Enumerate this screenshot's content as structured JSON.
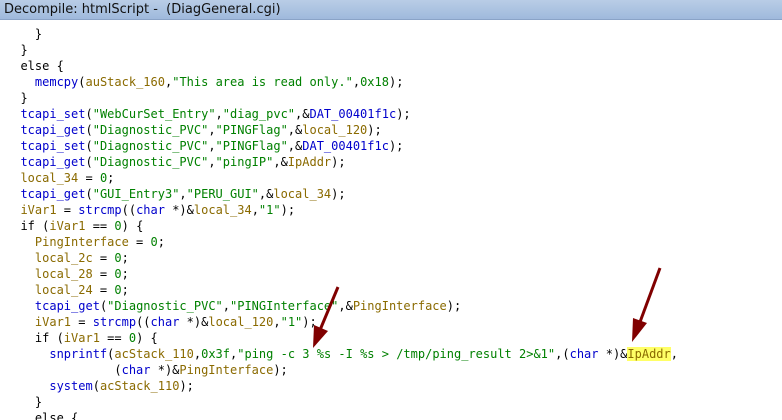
{
  "window": {
    "title": "Decompile: htmlScript -  (DiagGeneral.cgi)"
  },
  "code": {
    "lines": [
      [
        {
          "t": "    }",
          "c": "kw"
        }
      ],
      [
        {
          "t": "  }",
          "c": "kw"
        }
      ],
      [
        {
          "t": "  else {",
          "c": "kw"
        }
      ],
      [
        {
          "t": "    ",
          "c": "kw"
        },
        {
          "t": "memcpy",
          "c": "fn"
        },
        {
          "t": "(",
          "c": "kw"
        },
        {
          "t": "auStack_160",
          "c": "var"
        },
        {
          "t": ",",
          "c": "kw"
        },
        {
          "t": "\"This area is read only.\"",
          "c": "str"
        },
        {
          "t": ",",
          "c": "kw"
        },
        {
          "t": "0x18",
          "c": "num"
        },
        {
          "t": ");",
          "c": "kw"
        }
      ],
      [
        {
          "t": "  }",
          "c": "kw"
        }
      ],
      [
        {
          "t": "  ",
          "c": "kw"
        },
        {
          "t": "tcapi_set",
          "c": "fn"
        },
        {
          "t": "(",
          "c": "kw"
        },
        {
          "t": "\"WebCurSet_Entry\"",
          "c": "str"
        },
        {
          "t": ",",
          "c": "kw"
        },
        {
          "t": "\"diag_pvc\"",
          "c": "str"
        },
        {
          "t": ",&",
          "c": "kw"
        },
        {
          "t": "DAT_00401f1c",
          "c": "gvar"
        },
        {
          "t": ");",
          "c": "kw"
        }
      ],
      [
        {
          "t": "  ",
          "c": "kw"
        },
        {
          "t": "tcapi_get",
          "c": "fn"
        },
        {
          "t": "(",
          "c": "kw"
        },
        {
          "t": "\"Diagnostic_PVC\"",
          "c": "str"
        },
        {
          "t": ",",
          "c": "kw"
        },
        {
          "t": "\"PINGFlag\"",
          "c": "str"
        },
        {
          "t": ",&",
          "c": "kw"
        },
        {
          "t": "local_120",
          "c": "var"
        },
        {
          "t": ");",
          "c": "kw"
        }
      ],
      [
        {
          "t": "  ",
          "c": "kw"
        },
        {
          "t": "tcapi_set",
          "c": "fn"
        },
        {
          "t": "(",
          "c": "kw"
        },
        {
          "t": "\"Diagnostic_PVC\"",
          "c": "str"
        },
        {
          "t": ",",
          "c": "kw"
        },
        {
          "t": "\"PINGFlag\"",
          "c": "str"
        },
        {
          "t": ",&",
          "c": "kw"
        },
        {
          "t": "DAT_00401f1c",
          "c": "gvar"
        },
        {
          "t": ");",
          "c": "kw"
        }
      ],
      [
        {
          "t": "  ",
          "c": "kw"
        },
        {
          "t": "tcapi_get",
          "c": "fn"
        },
        {
          "t": "(",
          "c": "kw"
        },
        {
          "t": "\"Diagnostic_PVC\"",
          "c": "str"
        },
        {
          "t": ",",
          "c": "kw"
        },
        {
          "t": "\"pingIP\"",
          "c": "str"
        },
        {
          "t": ",&",
          "c": "kw"
        },
        {
          "t": "IpAddr",
          "c": "var"
        },
        {
          "t": ");",
          "c": "kw"
        }
      ],
      [
        {
          "t": "  ",
          "c": "kw"
        },
        {
          "t": "local_34",
          "c": "var"
        },
        {
          "t": " = ",
          "c": "kw"
        },
        {
          "t": "0",
          "c": "num"
        },
        {
          "t": ";",
          "c": "kw"
        }
      ],
      [
        {
          "t": "  ",
          "c": "kw"
        },
        {
          "t": "tcapi_get",
          "c": "fn"
        },
        {
          "t": "(",
          "c": "kw"
        },
        {
          "t": "\"GUI_Entry3\"",
          "c": "str"
        },
        {
          "t": ",",
          "c": "kw"
        },
        {
          "t": "\"PERU_GUI\"",
          "c": "str"
        },
        {
          "t": ",&",
          "c": "kw"
        },
        {
          "t": "local_34",
          "c": "var"
        },
        {
          "t": ");",
          "c": "kw"
        }
      ],
      [
        {
          "t": "  ",
          "c": "kw"
        },
        {
          "t": "iVar1",
          "c": "var"
        },
        {
          "t": " = ",
          "c": "kw"
        },
        {
          "t": "strcmp",
          "c": "fn"
        },
        {
          "t": "((",
          "c": "kw"
        },
        {
          "t": "char",
          "c": "fn"
        },
        {
          "t": " *)&",
          "c": "kw"
        },
        {
          "t": "local_34",
          "c": "var"
        },
        {
          "t": ",",
          "c": "kw"
        },
        {
          "t": "\"1\"",
          "c": "str"
        },
        {
          "t": ");",
          "c": "kw"
        }
      ],
      [
        {
          "t": "  if (",
          "c": "kw"
        },
        {
          "t": "iVar1",
          "c": "var"
        },
        {
          "t": " == ",
          "c": "kw"
        },
        {
          "t": "0",
          "c": "num"
        },
        {
          "t": ") {",
          "c": "kw"
        }
      ],
      [
        {
          "t": "    ",
          "c": "kw"
        },
        {
          "t": "PingInterface",
          "c": "var"
        },
        {
          "t": " = ",
          "c": "kw"
        },
        {
          "t": "0",
          "c": "num"
        },
        {
          "t": ";",
          "c": "kw"
        }
      ],
      [
        {
          "t": "    ",
          "c": "kw"
        },
        {
          "t": "local_2c",
          "c": "var"
        },
        {
          "t": " = ",
          "c": "kw"
        },
        {
          "t": "0",
          "c": "num"
        },
        {
          "t": ";",
          "c": "kw"
        }
      ],
      [
        {
          "t": "    ",
          "c": "kw"
        },
        {
          "t": "local_28",
          "c": "var"
        },
        {
          "t": " = ",
          "c": "kw"
        },
        {
          "t": "0",
          "c": "num"
        },
        {
          "t": ";",
          "c": "kw"
        }
      ],
      [
        {
          "t": "    ",
          "c": "kw"
        },
        {
          "t": "local_24",
          "c": "var"
        },
        {
          "t": " = ",
          "c": "kw"
        },
        {
          "t": "0",
          "c": "num"
        },
        {
          "t": ";",
          "c": "kw"
        }
      ],
      [
        {
          "t": "    ",
          "c": "kw"
        },
        {
          "t": "tcapi_get",
          "c": "fn"
        },
        {
          "t": "(",
          "c": "kw"
        },
        {
          "t": "\"Diagnostic_PVC\"",
          "c": "str"
        },
        {
          "t": ",",
          "c": "kw"
        },
        {
          "t": "\"PINGInterface\"",
          "c": "str"
        },
        {
          "t": ",&",
          "c": "kw"
        },
        {
          "t": "PingInterface",
          "c": "var"
        },
        {
          "t": ");",
          "c": "kw"
        }
      ],
      [
        {
          "t": "    ",
          "c": "kw"
        },
        {
          "t": "iVar1",
          "c": "var"
        },
        {
          "t": " = ",
          "c": "kw"
        },
        {
          "t": "strcmp",
          "c": "fn"
        },
        {
          "t": "((",
          "c": "kw"
        },
        {
          "t": "char",
          "c": "fn"
        },
        {
          "t": " *)&",
          "c": "kw"
        },
        {
          "t": "local_120",
          "c": "var"
        },
        {
          "t": ",",
          "c": "kw"
        },
        {
          "t": "\"1\"",
          "c": "str"
        },
        {
          "t": ");",
          "c": "kw"
        }
      ],
      [
        {
          "t": "    if (",
          "c": "kw"
        },
        {
          "t": "iVar1",
          "c": "var"
        },
        {
          "t": " == ",
          "c": "kw"
        },
        {
          "t": "0",
          "c": "num"
        },
        {
          "t": ") {",
          "c": "kw"
        }
      ],
      [
        {
          "t": "      ",
          "c": "kw"
        },
        {
          "t": "snprintf",
          "c": "fn"
        },
        {
          "t": "(",
          "c": "kw"
        },
        {
          "t": "acStack_110",
          "c": "var"
        },
        {
          "t": ",",
          "c": "kw"
        },
        {
          "t": "0x3f",
          "c": "num"
        },
        {
          "t": ",",
          "c": "kw"
        },
        {
          "t": "\"ping -c 3 %s -I %s > /tmp/ping_result 2>&1\"",
          "c": "str"
        },
        {
          "t": ",(",
          "c": "kw"
        },
        {
          "t": "char",
          "c": "fn"
        },
        {
          "t": " *)&",
          "c": "kw"
        },
        {
          "t": "IpAddr",
          "c": "var hl"
        },
        {
          "t": ",",
          "c": "kw"
        }
      ],
      [
        {
          "t": "               (",
          "c": "kw"
        },
        {
          "t": "char",
          "c": "fn"
        },
        {
          "t": " *)&",
          "c": "kw"
        },
        {
          "t": "PingInterface",
          "c": "var"
        },
        {
          "t": ");",
          "c": "kw"
        }
      ],
      [
        {
          "t": "      ",
          "c": "kw"
        },
        {
          "t": "system",
          "c": "fn"
        },
        {
          "t": "(",
          "c": "kw"
        },
        {
          "t": "acStack_110",
          "c": "var"
        },
        {
          "t": ");",
          "c": "kw"
        }
      ],
      [
        {
          "t": "    }",
          "c": "kw"
        }
      ],
      [
        {
          "t": "    else {",
          "c": "kw"
        }
      ]
    ]
  },
  "annotations": {
    "arrow_color": "#800000"
  }
}
